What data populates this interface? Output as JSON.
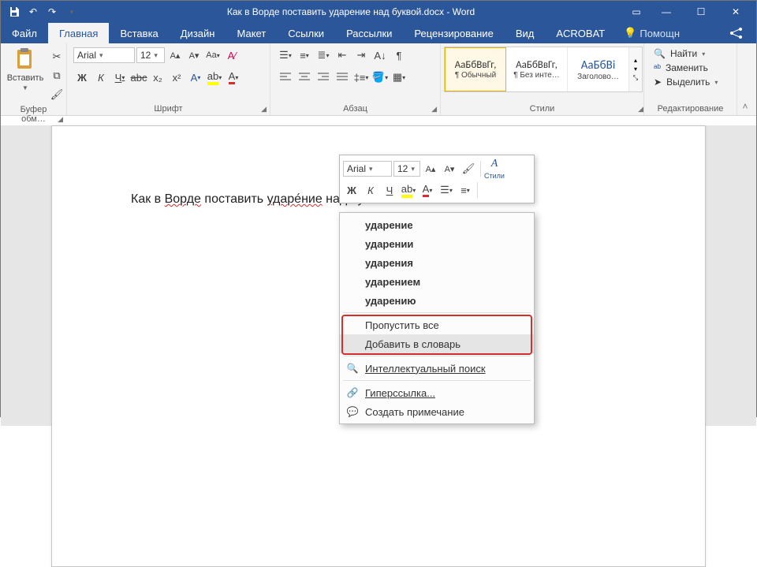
{
  "titlebar": {
    "title": "Как в Ворде поставить ударение над буквой.docx - Word"
  },
  "tabs": {
    "file": "Файл",
    "home": "Главная",
    "insert": "Вставка",
    "design": "Дизайн",
    "layout": "Макет",
    "references": "Ссылки",
    "mailings": "Рассылки",
    "review": "Рецензирование",
    "view": "Вид",
    "acrobat": "ACROBAT",
    "tell_me": "Помощн"
  },
  "ribbon": {
    "clipboard": {
      "paste": "Вставить",
      "group": "Буфер обм…"
    },
    "font": {
      "name": "Arial",
      "size": "12",
      "group": "Шрифт"
    },
    "paragraph": {
      "group": "Абзац"
    },
    "styles": {
      "group": "Стили",
      "items": [
        {
          "preview": "АаБбВвГг,",
          "name": "¶ Обычный"
        },
        {
          "preview": "АаБбВвГг,",
          "name": "¶ Без инте…"
        },
        {
          "preview": "АаБбВі",
          "name": "Заголово…"
        }
      ]
    },
    "editing": {
      "group": "Редактирование",
      "find": "Найти",
      "replace": "Заменить",
      "select": "Выделить"
    }
  },
  "document": {
    "text_before": "Как в ",
    "word1": "Ворде",
    "text_mid": " поставить ",
    "word2": "ударе́ние",
    "text_after": " над буквой"
  },
  "mini": {
    "font": "Arial",
    "size": "12",
    "styles_label": "Стили"
  },
  "context": {
    "sugg1": "ударение",
    "sugg2": "ударении",
    "sugg3": "ударения",
    "sugg4": "ударением",
    "sugg5": "ударению",
    "ignore_all": "Пропустить все",
    "add_dict": "Добавить в словарь",
    "smart_lookup": "Интеллектуальный поиск",
    "hyperlink": "Гиперссылка...",
    "new_comment": "Создать примечание"
  }
}
